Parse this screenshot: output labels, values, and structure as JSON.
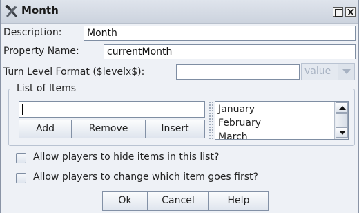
{
  "window": {
    "title": "Month",
    "icon": "tools-x-icon",
    "controls": [
      "maximize-icon",
      "close-icon"
    ]
  },
  "form": {
    "description_label": "Description:",
    "description_value": "Month",
    "property_label": "Property Name:",
    "property_value": "currentMonth",
    "turn_format_label": "Turn Level Format ($levelx$):",
    "turn_format_value": "",
    "value_combo_label": "value"
  },
  "list_group": {
    "title": "List of Items",
    "input_value": "",
    "buttons": {
      "add": "Add",
      "remove": "Remove",
      "insert": "Insert"
    },
    "items": [
      "January",
      "February",
      "March"
    ]
  },
  "options": {
    "hide_items_label": "Allow players to hide items in this list?",
    "hide_items_checked": false,
    "change_order_label": "Allow players to change which item goes first?",
    "change_order_checked": false
  },
  "footer": {
    "ok": "Ok",
    "cancel": "Cancel",
    "help": "Help"
  },
  "colors": {
    "window_bg": "#eef1f6",
    "border": "#7f8ea3",
    "disabled_text": "#a7b2c2"
  }
}
